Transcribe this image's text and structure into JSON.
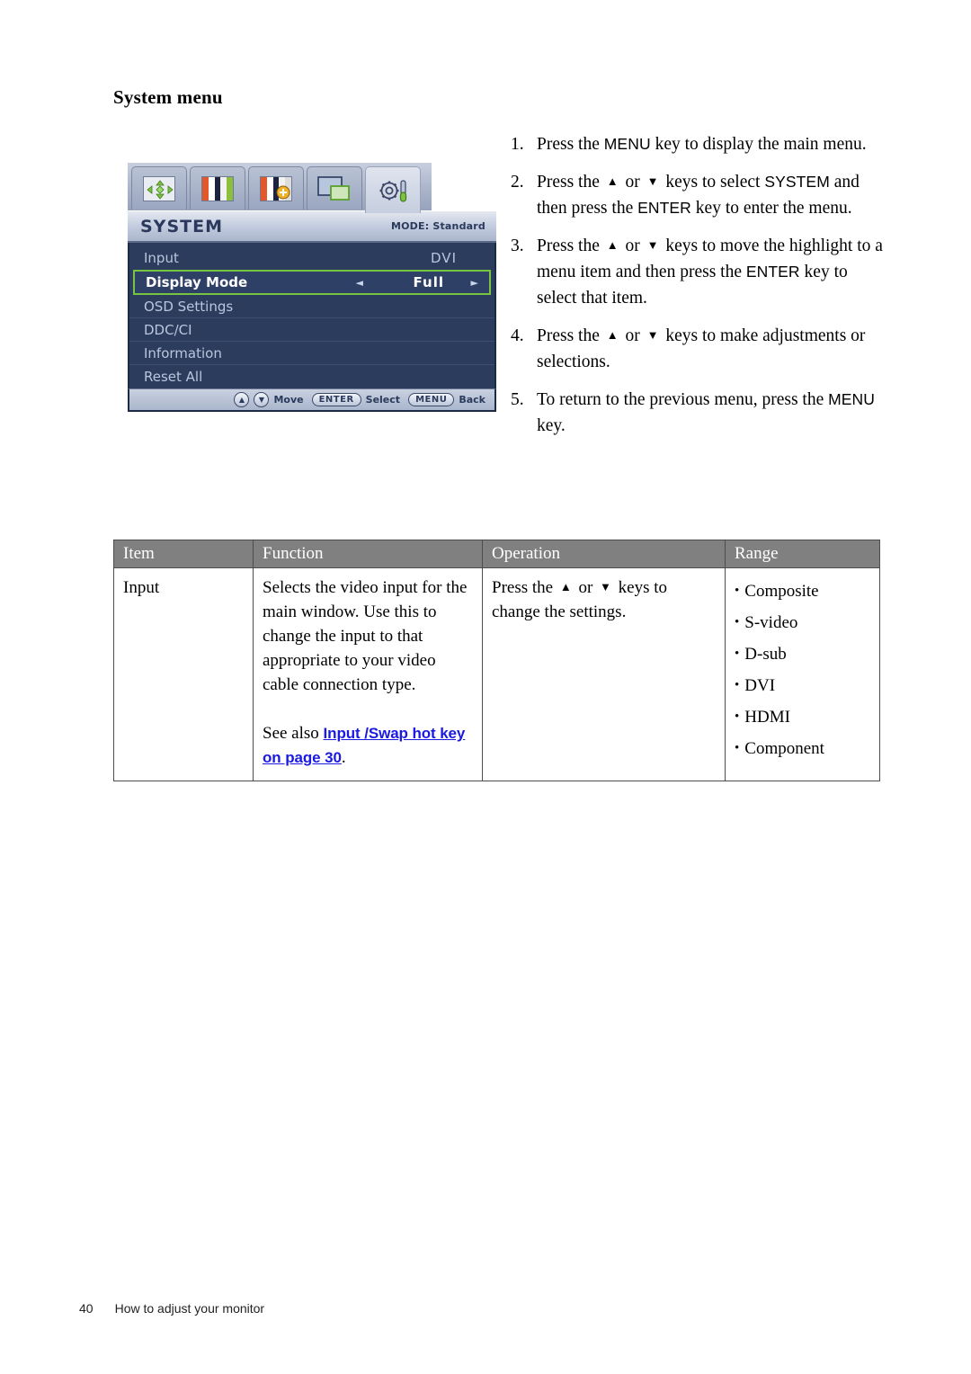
{
  "document": {
    "section_title": "System menu",
    "footer": {
      "page_number": "40",
      "running_head": "How to adjust your monitor"
    }
  },
  "osd": {
    "title": "SYSTEM",
    "mode_label": "MODE: Standard",
    "tabs": [
      {
        "name": "display-tab",
        "icon": "move-arrows-icon",
        "active": false
      },
      {
        "name": "picture-tab",
        "icon": "color-bars-icon",
        "active": false
      },
      {
        "name": "picture-advanced-tab",
        "icon": "color-bars-plus-icon",
        "active": false
      },
      {
        "name": "pip-tab",
        "icon": "picture-in-picture-icon",
        "active": false
      },
      {
        "name": "system-tab",
        "icon": "gear-wrench-icon",
        "active": true
      }
    ],
    "rows": [
      {
        "label": "Input",
        "value": "DVI",
        "highlighted": false
      },
      {
        "label": "Display Mode",
        "value": "Full",
        "highlighted": true
      },
      {
        "label": "OSD Settings",
        "value": "",
        "highlighted": false
      },
      {
        "label": "DDC/CI",
        "value": "",
        "highlighted": false
      },
      {
        "label": "Information",
        "value": "",
        "highlighted": false
      },
      {
        "label": "Reset All",
        "value": "",
        "highlighted": false
      }
    ],
    "footer_hints": [
      {
        "key": "▲",
        "kind": "round"
      },
      {
        "key": "▼",
        "kind": "round"
      },
      {
        "key": "Move",
        "kind": "text"
      },
      {
        "key": "ENTER",
        "kind": "pill"
      },
      {
        "key": "Select",
        "kind": "text"
      },
      {
        "key": "MENU",
        "kind": "pill"
      },
      {
        "key": "Back",
        "kind": "text"
      }
    ]
  },
  "steps": [
    {
      "num": "1.",
      "parts": [
        {
          "t": "Press the ",
          "s": "plain"
        },
        {
          "t": "MENU",
          "s": "kbd"
        },
        {
          "t": " key to display the main menu.",
          "s": "plain"
        }
      ]
    },
    {
      "num": "2.",
      "parts": [
        {
          "t": "Press the ",
          "s": "plain"
        },
        {
          "t": "▲",
          "s": "tri-up"
        },
        {
          "t": " or ",
          "s": "plain"
        },
        {
          "t": "▼",
          "s": "tri-dn"
        },
        {
          "t": " keys to select ",
          "s": "plain"
        },
        {
          "t": "SYSTEM",
          "s": "kbd"
        },
        {
          "t": " and then press the ",
          "s": "plain"
        },
        {
          "t": "ENTER",
          "s": "kbd"
        },
        {
          "t": " key to enter the menu.",
          "s": "plain"
        }
      ]
    },
    {
      "num": "3.",
      "parts": [
        {
          "t": "Press the ",
          "s": "plain"
        },
        {
          "t": "▲",
          "s": "tri-up"
        },
        {
          "t": " or ",
          "s": "plain"
        },
        {
          "t": "▼",
          "s": "tri-dn"
        },
        {
          "t": " keys to move the highlight to a menu item and then press the ",
          "s": "plain"
        },
        {
          "t": "ENTER",
          "s": "kbd"
        },
        {
          "t": " key to select that item.",
          "s": "plain"
        }
      ]
    },
    {
      "num": "4.",
      "parts": [
        {
          "t": "Press the ",
          "s": "plain"
        },
        {
          "t": "▲",
          "s": "tri-up"
        },
        {
          "t": " or ",
          "s": "plain"
        },
        {
          "t": "▼",
          "s": "tri-dn"
        },
        {
          "t": " keys to make adjustments or selections.",
          "s": "plain"
        }
      ]
    },
    {
      "num": "5.",
      "parts": [
        {
          "t": "To return to the previous menu, press the ",
          "s": "plain"
        },
        {
          "t": "MENU",
          "s": "kbd"
        },
        {
          "t": " key.",
          "s": "plain"
        }
      ]
    }
  ],
  "table": {
    "headers": [
      "Item",
      "Function",
      "Operation",
      "Range"
    ],
    "rows": [
      {
        "item": "Input",
        "function_text": "Selects the video input for the main window. Use this to change the input to that appropriate to your video cable connection type.",
        "see_also_prefix": "See also ",
        "see_also_link": "Input /Swap hot key on page 30",
        "see_also_suffix": ".",
        "operation_parts": [
          {
            "t": "Press the ",
            "s": "plain"
          },
          {
            "t": "▲",
            "s": "tri-up"
          },
          {
            "t": " or ",
            "s": "plain"
          },
          {
            "t": "▼",
            "s": "tri-dn"
          },
          {
            "t": " keys to change the settings.",
            "s": "plain"
          }
        ],
        "range": [
          "Composite",
          "S-video",
          "D-sub",
          "DVI",
          "HDMI",
          "Component"
        ]
      }
    ]
  },
  "colors": {
    "osd_body": "#2c3c5d",
    "osd_highlight_border": "#76c442",
    "table_header_bg": "#808080",
    "link_blue": "#1a1ae0"
  }
}
